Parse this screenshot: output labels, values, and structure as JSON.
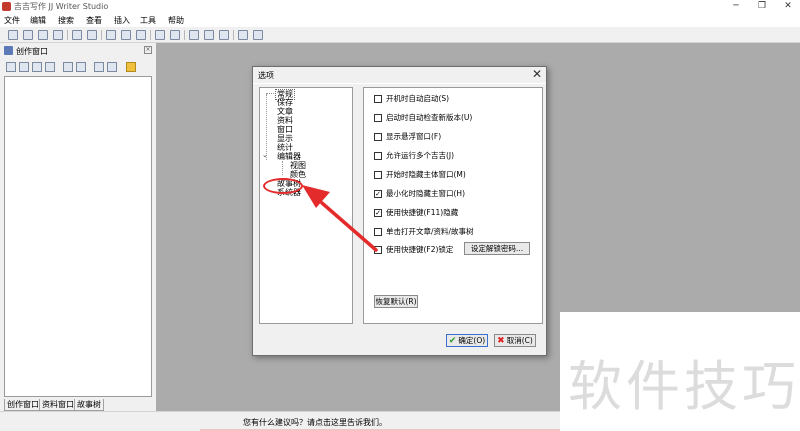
{
  "window": {
    "title": "吉吉写作 JJ Writer Studio",
    "min_glyph": "─",
    "max_glyph": "❐",
    "close_glyph": "✕"
  },
  "menu": [
    "文件",
    "编辑",
    "搜索",
    "查看",
    "插入",
    "工具",
    "帮助"
  ],
  "left_panel": {
    "title": "创作窗口",
    "close_glyph": "×",
    "tabs": [
      "创作窗口",
      "资料窗口",
      "故事树"
    ]
  },
  "status_bar": {
    "text": "您有什么建议吗？请点击这里告诉我们。"
  },
  "watermark": {
    "text": "软件技巧"
  },
  "dialog": {
    "title": "选项",
    "close_glyph": "✕",
    "tree": [
      "常规",
      "保存",
      "文章",
      "资料",
      "窗口",
      "显示",
      "统计",
      "编辑器",
      "视图",
      "颜色",
      "故事树",
      "系统器"
    ],
    "tree_expander": "⌄",
    "options": [
      {
        "label": "开机时自动启动(S)",
        "checked": false
      },
      {
        "label": "启动时自动检查新版本(U)",
        "checked": false
      },
      {
        "label": "显示悬浮窗口(F)",
        "checked": false
      },
      {
        "label": "允许运行多个吉吉(J)",
        "checked": false
      },
      {
        "label": "开始时隐藏主体窗口(M)",
        "checked": false
      },
      {
        "label": "最小化时隐藏主窗口(H)",
        "checked": true
      },
      {
        "label": "使用快捷键(F11)隐藏",
        "checked": true
      },
      {
        "label": "单击打开文章/资料/故事树",
        "checked": false
      },
      {
        "label": "使用快捷键(F2)锁定",
        "checked": false
      }
    ],
    "check_glyph": "✓",
    "set_password_button": "设定解锁密码...",
    "restore_default_button": "恢复默认(R)",
    "ok_button": "确定(O)",
    "cancel_button": "取消(C)"
  },
  "annotation": {
    "color": "#e42b2b",
    "target": "故事树"
  }
}
